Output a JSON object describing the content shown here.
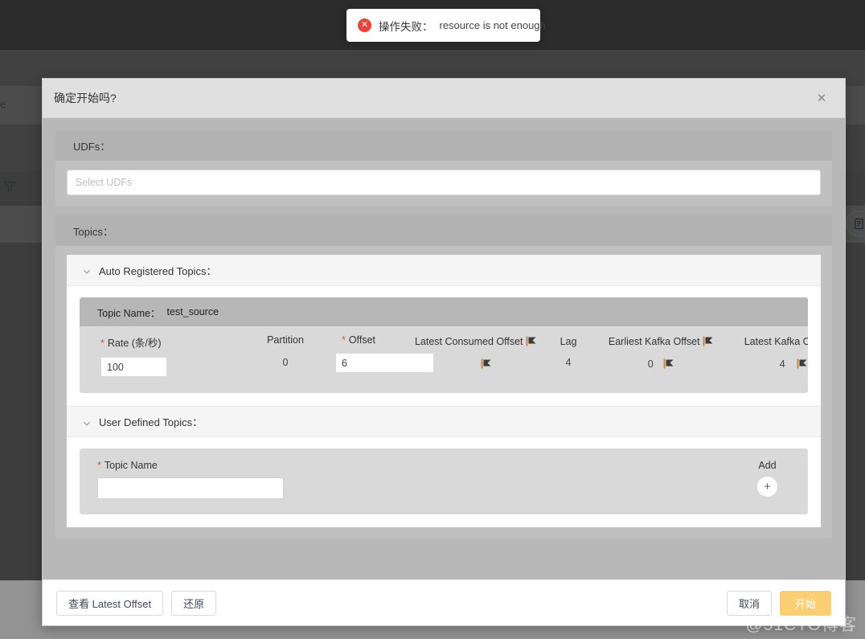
{
  "toast": {
    "icon": "error-circle-icon",
    "title": "操作失败：",
    "message": "resource is not enough"
  },
  "background": {
    "text_fragment": "e",
    "filter_icon": "filter-icon",
    "doc_icon": "document-icon"
  },
  "modal": {
    "title": "确定开始吗?",
    "close_icon": "close-icon",
    "udfs": {
      "label": "UDFs：",
      "select_placeholder": "Select UDFs"
    },
    "topics": {
      "label": "Topics：",
      "auto_registered": {
        "label": "Auto Registered Topics：",
        "chevron_icon": "chevron-down-icon",
        "topic": {
          "name_label": "Topic Name：",
          "name_value": "test_source",
          "columns": [
            {
              "label": "Rate (条/秒)",
              "required": true,
              "value": "100",
              "type": "input"
            },
            {
              "label": "Partition",
              "required": false,
              "value": "0",
              "type": "text"
            },
            {
              "label": "Offset",
              "required": true,
              "value": "6",
              "type": "input"
            },
            {
              "label": "Latest Consumed Offset",
              "required": false,
              "value": "",
              "type": "text",
              "label_icon": "broken-image-icon",
              "value_icon": "broken-image-icon"
            },
            {
              "label": "Lag",
              "required": false,
              "value": "4",
              "type": "text"
            },
            {
              "label": "Earliest Kafka Offset",
              "required": false,
              "value": "0",
              "type": "text",
              "label_icon": "broken-image-icon",
              "value_icon": "broken-image-icon"
            },
            {
              "label": "Latest Kafka Offset",
              "required": false,
              "value": "4",
              "type": "text",
              "label_icon": "broken-image-icon",
              "value_icon": "broken-image-icon"
            }
          ]
        }
      },
      "user_defined": {
        "label": "User Defined Topics：",
        "chevron_icon": "chevron-down-icon",
        "topic_name_label": "Topic Name",
        "topic_name_value": "",
        "add_label": "Add",
        "add_icon": "plus-icon"
      }
    },
    "footer": {
      "view_latest_offset": "查看 Latest Offset",
      "restore": "还原",
      "cancel": "取消",
      "start": "开始"
    }
  },
  "watermark": "@51CTO博客",
  "colors": {
    "primary_button": "#f9cf72",
    "error": "#f04134",
    "required_asterisk": "#e8502f"
  }
}
